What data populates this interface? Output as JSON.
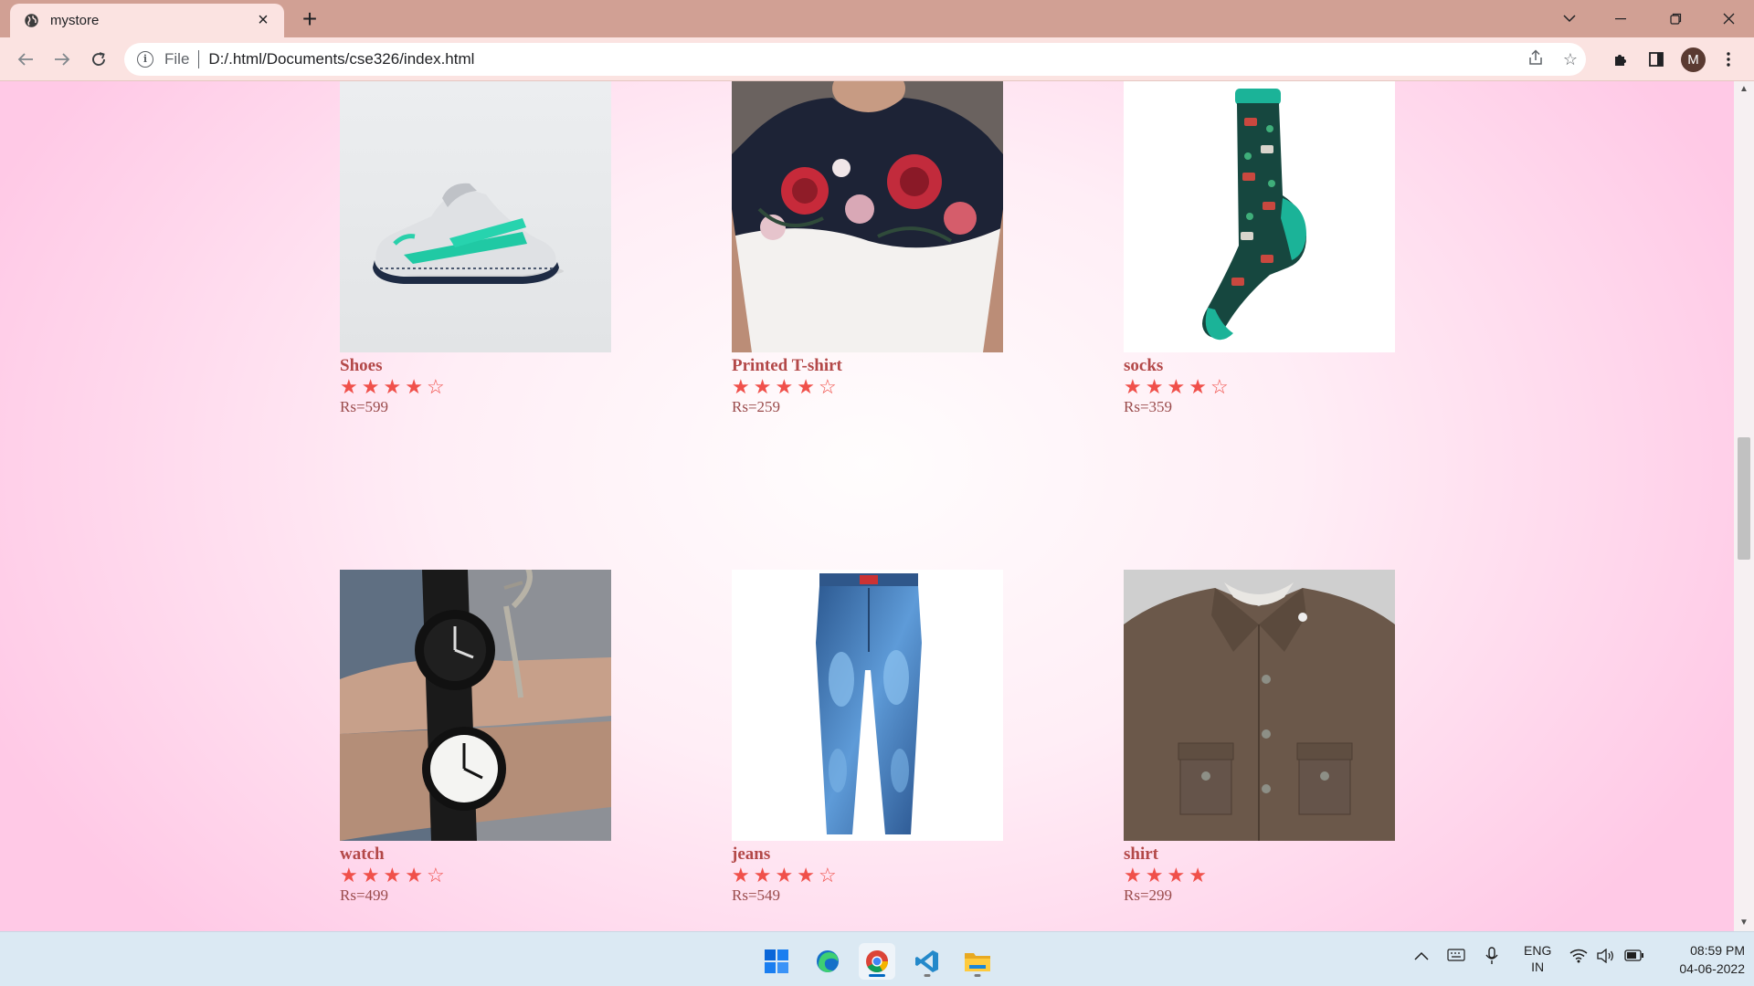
{
  "browser": {
    "tab_title": "mystore",
    "tab_close": "×",
    "new_tab": "+",
    "address_scheme": "File",
    "address_url": "D:/.html/Documents/cse326/index.html",
    "profile_initial": "M"
  },
  "products": [
    {
      "name": "Shoes",
      "rating": 4,
      "max_rating": 5,
      "price": "Rs=599",
      "image": "sneaker"
    },
    {
      "name": "Printed T-shirt",
      "rating": 4,
      "max_rating": 5,
      "price": "Rs=259",
      "image": "floral-tshirt"
    },
    {
      "name": "socks",
      "rating": 4,
      "max_rating": 5,
      "price": "Rs=359",
      "image": "sock"
    },
    {
      "name": "watch",
      "rating": 4,
      "max_rating": 5,
      "price": "Rs=499",
      "image": "wrist-watches"
    },
    {
      "name": "jeans",
      "rating": 4,
      "max_rating": 5,
      "price": "Rs=549",
      "image": "blue-jeans"
    },
    {
      "name": "shirt",
      "rating": 4,
      "max_rating": 4,
      "price": "Rs=299",
      "image": "brown-shirt"
    }
  ],
  "taskbar": {
    "lang_line1": "ENG",
    "lang_line2": "IN",
    "time": "08:59 PM",
    "date": "04-06-2022"
  },
  "colors": {
    "tabbar": "#d1a094",
    "toolbar": "#fbe3e1",
    "star": "#f0504a",
    "product_name": "#b34848"
  }
}
